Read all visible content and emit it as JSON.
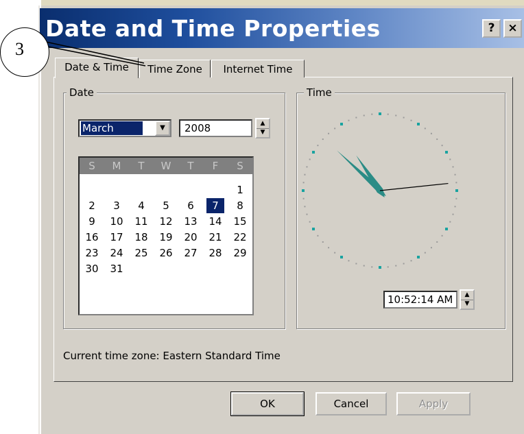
{
  "window": {
    "title": "Date and Time Properties",
    "help_label": "?",
    "close_label": "×"
  },
  "tabs": [
    {
      "label": "Date & Time",
      "active": true
    },
    {
      "label": "Time Zone",
      "active": false
    },
    {
      "label": "Internet Time",
      "active": false
    }
  ],
  "date_group": {
    "label": "Date",
    "month": "March",
    "year": "2008",
    "weekdays": [
      "S",
      "M",
      "T",
      "W",
      "T",
      "F",
      "S"
    ],
    "weeks": [
      [
        "",
        "",
        "",
        "",
        "",
        "",
        "1"
      ],
      [
        "2",
        "3",
        "4",
        "5",
        "6",
        "7",
        "8"
      ],
      [
        "9",
        "10",
        "11",
        "12",
        "13",
        "14",
        "15"
      ],
      [
        "16",
        "17",
        "18",
        "19",
        "20",
        "21",
        "22"
      ],
      [
        "23",
        "24",
        "25",
        "26",
        "27",
        "28",
        "29"
      ],
      [
        "30",
        "31",
        "",
        "",
        "",
        "",
        ""
      ]
    ],
    "selected_day": "7"
  },
  "time_group": {
    "label": "Time",
    "time_value": "10:52:14 AM",
    "hand_color": "#2b8c86",
    "second_hand_color": "#000000"
  },
  "current_time_zone": "Current time zone:  Eastern Standard Time",
  "buttons": {
    "ok": "OK",
    "cancel": "Cancel",
    "apply": "Apply"
  },
  "annotation": {
    "callout_number": "3"
  },
  "colors": {
    "titlebar_start": "#0a2e6e",
    "titlebar_end": "#a8c0e6",
    "dialog_face": "#d4d0c8",
    "selection": "#0a246a"
  }
}
